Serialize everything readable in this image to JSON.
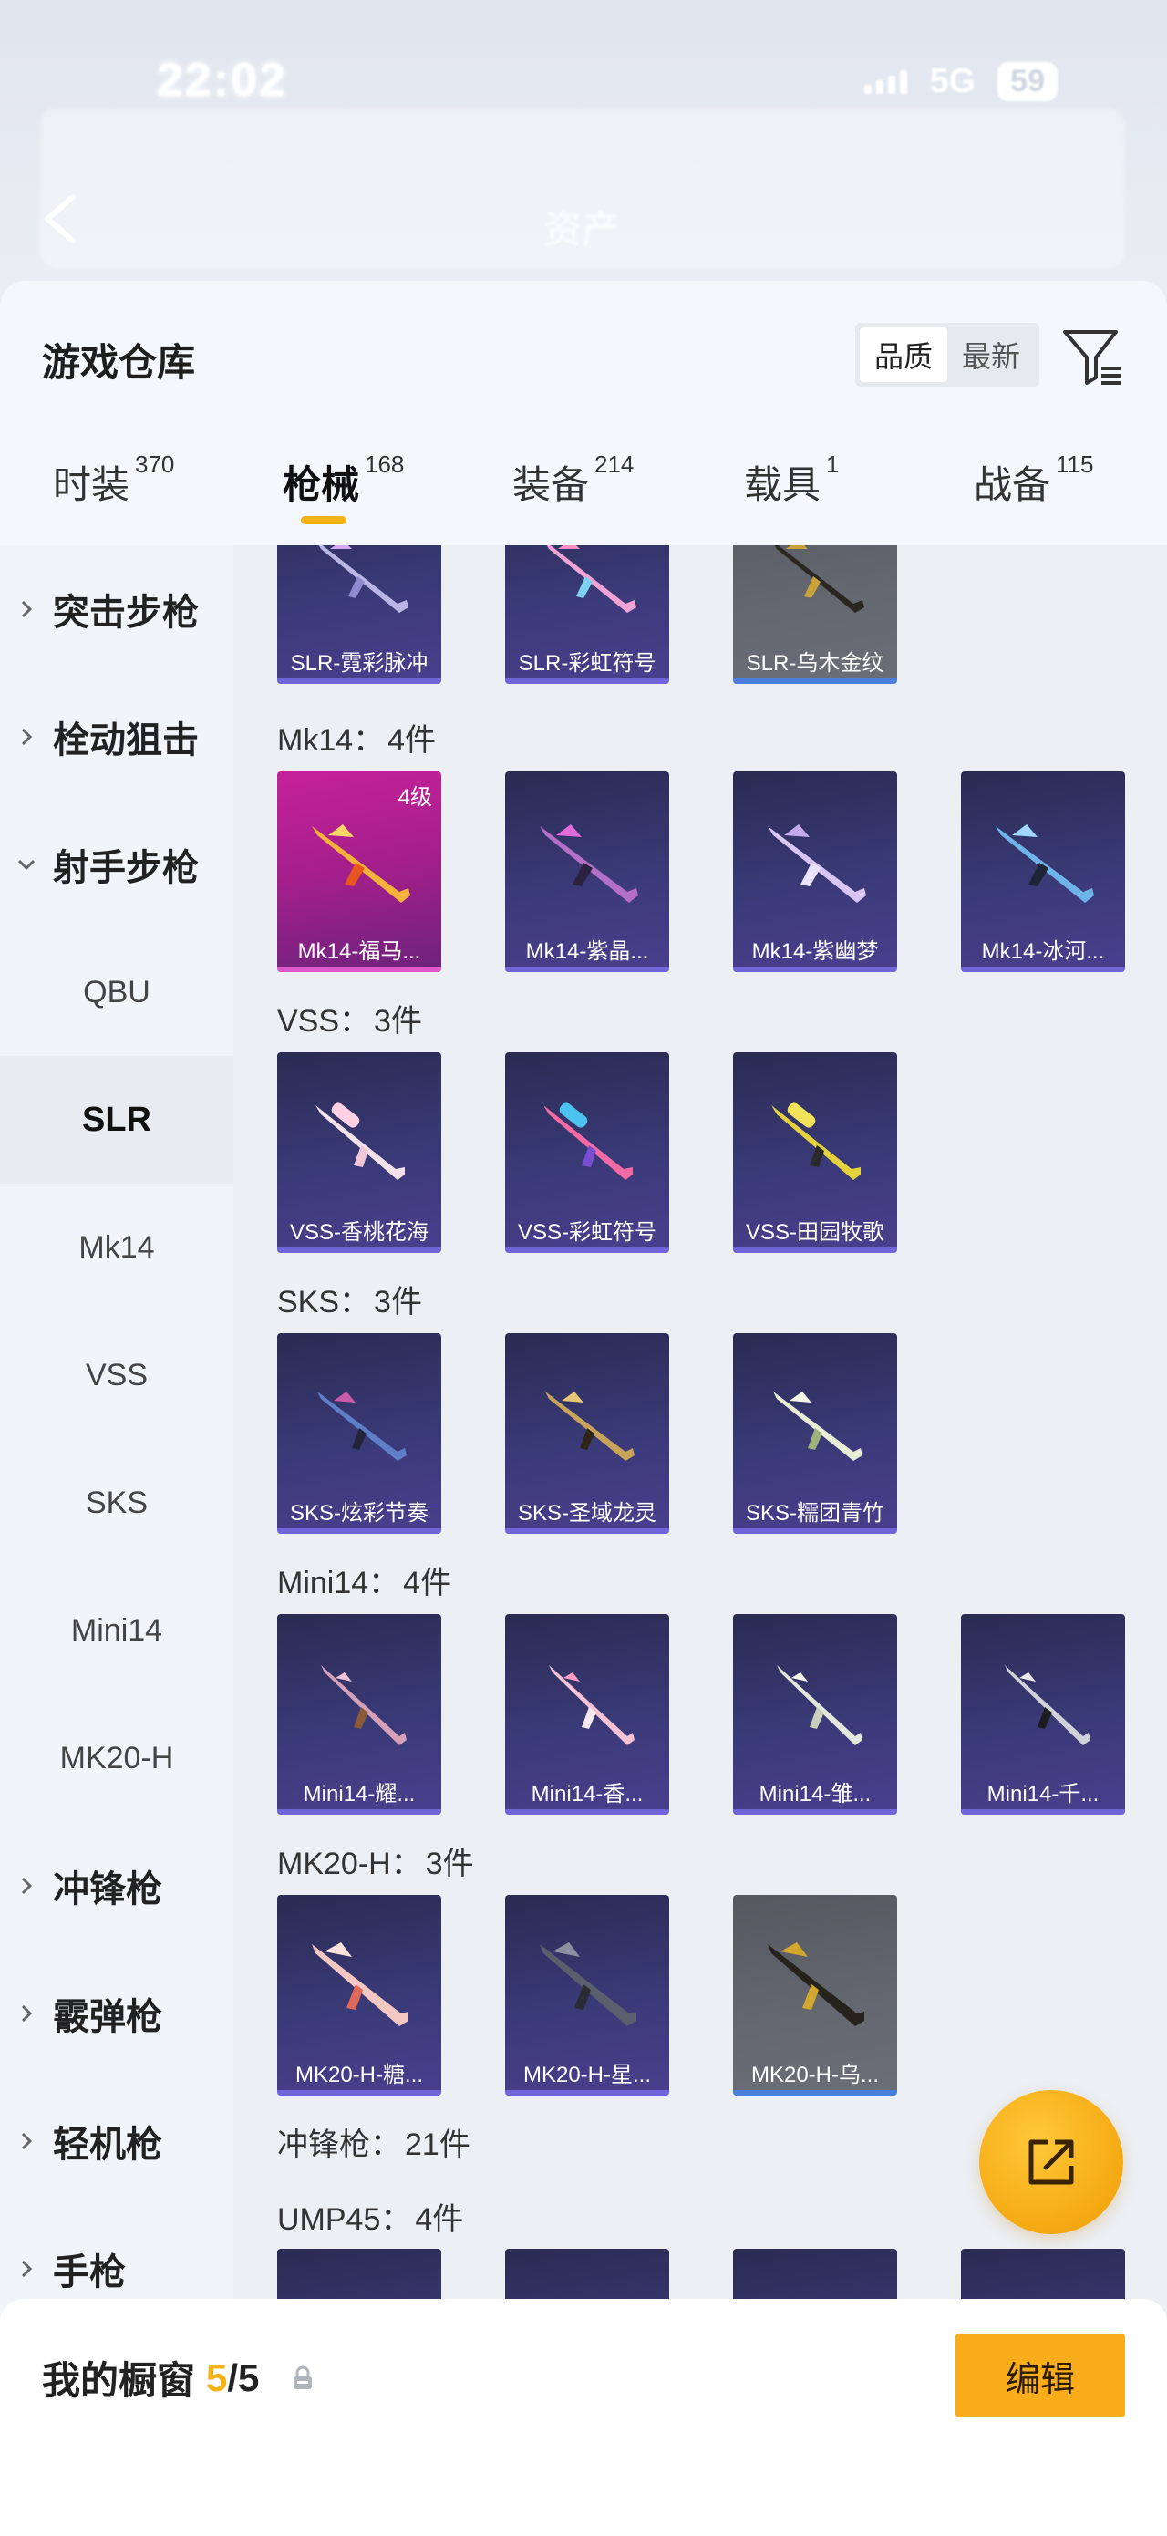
{
  "status_bar": {
    "time": "22:02",
    "network": "5G",
    "battery": "59"
  },
  "page_title_blur": "资产",
  "sheet": {
    "title": "游戏仓库",
    "sort_options": [
      "品质",
      "最新"
    ],
    "active_sort": "品质"
  },
  "tabs": [
    {
      "label": "时装",
      "count": "370"
    },
    {
      "label": "枪械",
      "count": "168"
    },
    {
      "label": "装备",
      "count": "214"
    },
    {
      "label": "载具",
      "count": "1"
    },
    {
      "label": "战备",
      "count": "115"
    }
  ],
  "sidebar": {
    "categories": {
      "assault": "突击步枪",
      "bolt": "栓动狙击",
      "marksman": "射手步枪",
      "smg": "冲锋枪",
      "shotgun": "霰弹枪",
      "lmg": "轻机枪",
      "pistol": "手枪"
    },
    "subs": [
      "QBU",
      "SLR",
      "Mk14",
      "VSS",
      "SKS",
      "Mini14",
      "MK20-H"
    ],
    "active_sub": "SLR"
  },
  "groups": {
    "slr": {
      "items": [
        "SLR-霓彩脉冲",
        "SLR-彩虹符号",
        "SLR-乌木金纹"
      ]
    },
    "mk14": {
      "label": "Mk14：",
      "count": "4件",
      "items": [
        "Mk14-福马...",
        "Mk14-紫晶...",
        "Mk14-紫幽梦",
        "Mk14-冰河..."
      ],
      "first_level": "4级"
    },
    "vss": {
      "label": "VSS：",
      "count": "3件",
      "items": [
        "VSS-香桃花海",
        "VSS-彩虹符号",
        "VSS-田园牧歌"
      ]
    },
    "sks": {
      "label": "SKS：",
      "count": "3件",
      "items": [
        "SKS-炫彩节奏",
        "SKS-圣域龙灵",
        "SKS-糯团青竹"
      ]
    },
    "mini14": {
      "label": "Mini14：",
      "count": "4件",
      "items": [
        "Mini14-耀...",
        "Mini14-香...",
        "Mini14-雏...",
        "Mini14-千..."
      ]
    },
    "mk20": {
      "label": "MK20-H：",
      "count": "3件",
      "items": [
        "MK20-H-糖...",
        "MK20-H-星...",
        "MK20-H-乌..."
      ]
    },
    "smg": {
      "label": "冲锋枪：",
      "count": "21件"
    },
    "ump45": {
      "label": "UMP45：",
      "count": "4件"
    }
  },
  "showcase": {
    "label": "我的橱窗",
    "current": "5",
    "separator": "/",
    "max": "5",
    "edit_label": "编辑"
  },
  "colors": {
    "accent": "#f5b316",
    "card_bg": "#3a3a78",
    "card_grey": "#646870",
    "card_pink": "#c6219a"
  },
  "icons": [
    "back-icon",
    "filter-icon",
    "chevron-right-icon",
    "chevron-down-icon",
    "share-icon",
    "lock-icon"
  ]
}
